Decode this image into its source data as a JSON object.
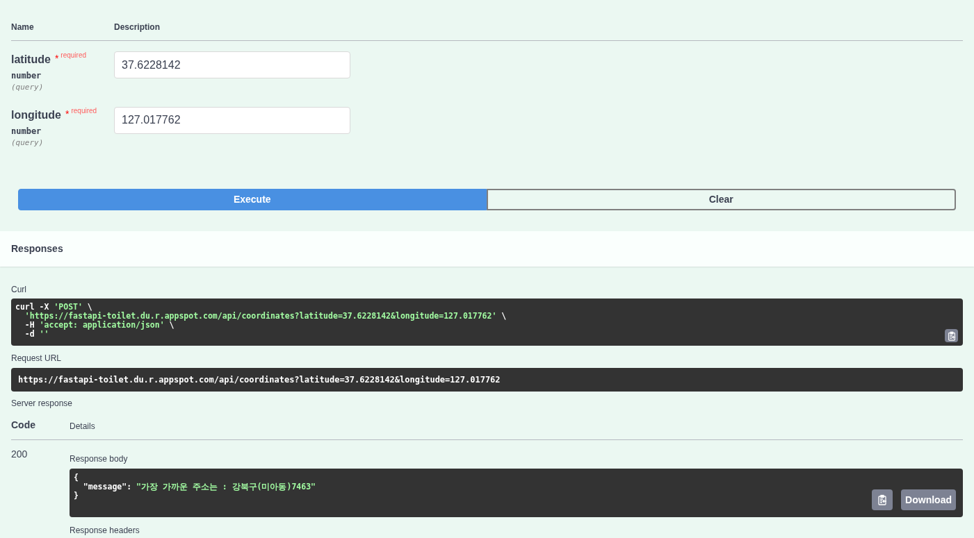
{
  "parameters": {
    "columns": [
      "Name",
      "Description"
    ],
    "rows": [
      {
        "name": "latitude",
        "required_mark": "*",
        "required": "required",
        "type": "number",
        "location": "(query)",
        "value": "37.6228142"
      },
      {
        "name": "longitude",
        "required_mark": "*",
        "required": "required",
        "type": "number",
        "location": "(query)",
        "value": "127.017762"
      }
    ]
  },
  "buttons": [
    {
      "label": "Execute",
      "kind": "primary"
    },
    {
      "label": "Clear",
      "kind": "secondary"
    }
  ],
  "responses": {
    "title": "Responses",
    "curl_label": "Curl",
    "curl_lines": [
      [
        {
          "text": "curl -X ",
          "kind": "plain"
        },
        {
          "text": "'POST'",
          "kind": "string"
        },
        {
          "text": " \\",
          "kind": "plain"
        }
      ],
      [
        {
          "text": "  'https://fastapi-toilet.du.r.appspot.com/api/coordinates?latitude=37.6228142&longitude=127.017762'",
          "kind": "string"
        },
        {
          "text": " \\",
          "kind": "plain"
        }
      ],
      [
        {
          "text": "  -H ",
          "kind": "plain"
        },
        {
          "text": "'accept: application/json'",
          "kind": "string"
        },
        {
          "text": " \\",
          "kind": "plain"
        }
      ],
      [
        {
          "text": "  -d ",
          "kind": "plain"
        },
        {
          "text": "''",
          "kind": "string"
        }
      ]
    ],
    "request_url_label": "Request URL",
    "request_url": "https://fastapi-toilet.du.r.appspot.com/api/coordinates?latitude=37.6228142&longitude=127.017762",
    "server_response_label": "Server response",
    "columns": [
      "Code",
      "Details"
    ],
    "code": "200",
    "body_label": "Response body",
    "body_lines": [
      [
        {
          "text": "{",
          "kind": "plain"
        }
      ],
      [
        {
          "text": "  \"message\"",
          "kind": "plain"
        },
        {
          "text": ": ",
          "kind": "plain"
        },
        {
          "text": "\"가장 가까운 주소는 : 강북구(미아동)7463\"",
          "kind": "string"
        }
      ],
      [
        {
          "text": "}",
          "kind": "plain"
        }
      ]
    ],
    "download": "Download",
    "headers_label": "Response headers"
  }
}
